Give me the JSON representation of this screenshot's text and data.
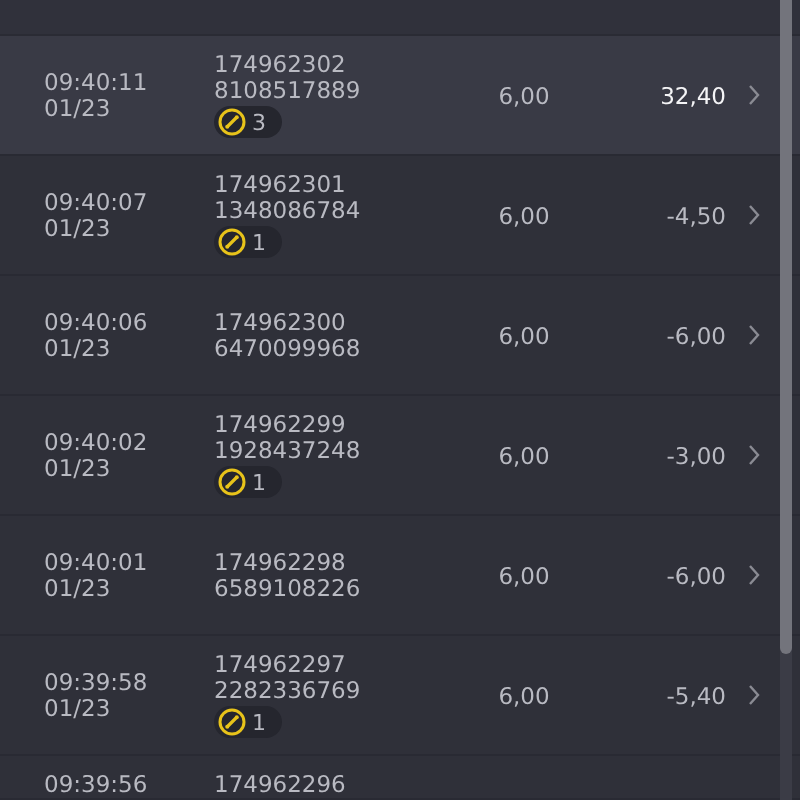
{
  "rows": [
    {
      "time": "09:40:11",
      "date": "01/23",
      "id_line1": "174962302",
      "id_line2": "8108517889",
      "badge": "3",
      "stake": "6,00",
      "result": "32,40",
      "kind": "win",
      "selected": true
    },
    {
      "time": "09:40:07",
      "date": "01/23",
      "id_line1": "174962301",
      "id_line2": "1348086784",
      "badge": "1",
      "stake": "6,00",
      "result": "-4,50",
      "kind": "loss",
      "selected": false
    },
    {
      "time": "09:40:06",
      "date": "01/23",
      "id_line1": "174962300",
      "id_line2": "6470099968",
      "stake": "6,00",
      "result": "-6,00",
      "kind": "loss",
      "selected": false
    },
    {
      "time": "09:40:02",
      "date": "01/23",
      "id_line1": "174962299",
      "id_line2": "1928437248",
      "badge": "1",
      "stake": "6,00",
      "result": "-3,00",
      "kind": "loss",
      "selected": false
    },
    {
      "time": "09:40:01",
      "date": "01/23",
      "id_line1": "174962298",
      "id_line2": "6589108226",
      "stake": "6,00",
      "result": "-6,00",
      "kind": "loss",
      "selected": false
    },
    {
      "time": "09:39:58",
      "date": "01/23",
      "id_line1": "174962297",
      "id_line2": "2282336769",
      "badge": "1",
      "stake": "6,00",
      "result": "-5,40",
      "kind": "loss",
      "selected": false
    },
    {
      "time": "09:39:56",
      "id_line1": "174962296",
      "selected": false
    }
  ]
}
